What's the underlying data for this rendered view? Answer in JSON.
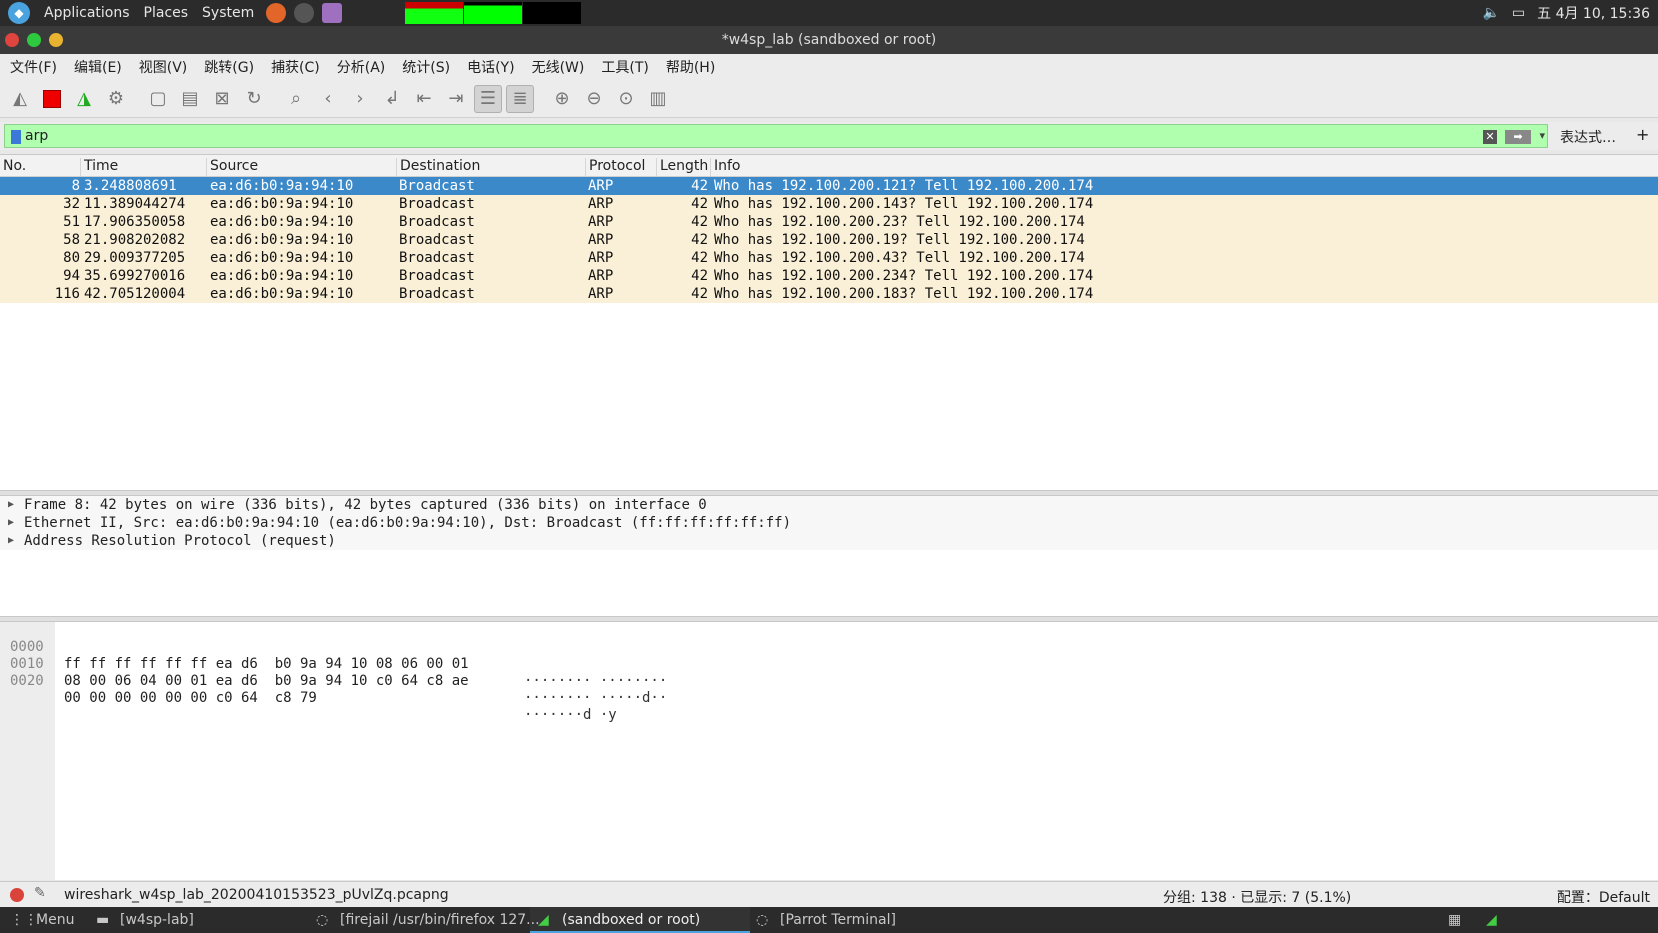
{
  "topbar": {
    "applications": "Applications",
    "places": "Places",
    "system": "System",
    "clock": "五 4月 10, 15:36"
  },
  "window": {
    "title": "*w4sp_lab (sandboxed or root)"
  },
  "menu": [
    "文件(F)",
    "编辑(E)",
    "视图(V)",
    "跳转(G)",
    "捕获(C)",
    "分析(A)",
    "统计(S)",
    "电话(Y)",
    "无线(W)",
    "工具(T)",
    "帮助(H)"
  ],
  "filter": {
    "value": "arp",
    "expression_label": "表达式…",
    "add_label": "+"
  },
  "packet_list": {
    "columns": [
      "No.",
      "Time",
      "Source",
      "Destination",
      "Protocol",
      "Length",
      "Info"
    ],
    "rows": [
      {
        "no": "8",
        "time": "3.248808691",
        "src": "ea:d6:b0:9a:94:10",
        "dst": "Broadcast",
        "proto": "ARP",
        "len": "42",
        "info": "Who has 192.100.200.121? Tell 192.100.200.174"
      },
      {
        "no": "32",
        "time": "11.389044274",
        "src": "ea:d6:b0:9a:94:10",
        "dst": "Broadcast",
        "proto": "ARP",
        "len": "42",
        "info": "Who has 192.100.200.143? Tell 192.100.200.174"
      },
      {
        "no": "51",
        "time": "17.906350058",
        "src": "ea:d6:b0:9a:94:10",
        "dst": "Broadcast",
        "proto": "ARP",
        "len": "42",
        "info": "Who has 192.100.200.23? Tell 192.100.200.174"
      },
      {
        "no": "58",
        "time": "21.908202082",
        "src": "ea:d6:b0:9a:94:10",
        "dst": "Broadcast",
        "proto": "ARP",
        "len": "42",
        "info": "Who has 192.100.200.19? Tell 192.100.200.174"
      },
      {
        "no": "80",
        "time": "29.009377205",
        "src": "ea:d6:b0:9a:94:10",
        "dst": "Broadcast",
        "proto": "ARP",
        "len": "42",
        "info": "Who has 192.100.200.43? Tell 192.100.200.174"
      },
      {
        "no": "94",
        "time": "35.699270016",
        "src": "ea:d6:b0:9a:94:10",
        "dst": "Broadcast",
        "proto": "ARP",
        "len": "42",
        "info": "Who has 192.100.200.234? Tell 192.100.200.174"
      },
      {
        "no": "116",
        "time": "42.705120004",
        "src": "ea:d6:b0:9a:94:10",
        "dst": "Broadcast",
        "proto": "ARP",
        "len": "42",
        "info": "Who has 192.100.200.183? Tell 192.100.200.174"
      }
    ]
  },
  "details": [
    "Frame 8: 42 bytes on wire (336 bits), 42 bytes captured (336 bits) on interface 0",
    "Ethernet II, Src: ea:d6:b0:9a:94:10 (ea:d6:b0:9a:94:10), Dst: Broadcast (ff:ff:ff:ff:ff:ff)",
    "Address Resolution Protocol (request)"
  ],
  "bytes": [
    {
      "offset": "0000",
      "hex": "ff ff ff ff ff ff ea d6  b0 9a 94 10 08 06 00 01",
      "ascii": "········ ········"
    },
    {
      "offset": "0010",
      "hex": "08 00 06 04 00 01 ea d6  b0 9a 94 10 c0 64 c8 ae",
      "ascii": "········ ·····d··"
    },
    {
      "offset": "0020",
      "hex": "00 00 00 00 00 00 c0 64  c8 79",
      "ascii": "·······d ·y"
    }
  ],
  "status": {
    "file": "wireshark_w4sp_lab_20200410153523_pUvlZq.pcapng",
    "stats": "分组: 138 · 已显示: 7 (5.1%)",
    "profile": "配置：Default"
  },
  "taskbar": {
    "menu": "Menu",
    "items": [
      "[w4sp-lab]",
      "[firejail /usr/bin/firefox 127...",
      "(sandboxed or root)",
      "[Parrot Terminal]"
    ]
  }
}
